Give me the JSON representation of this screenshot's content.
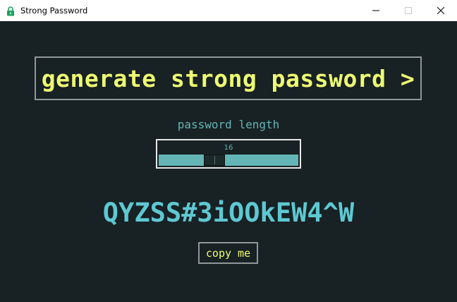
{
  "window": {
    "title": "Strong Password",
    "icon": "lock-icon",
    "controls": [
      "minimize-icon",
      "maximize-icon",
      "close-icon"
    ]
  },
  "main": {
    "generate_label": "generate strong password >",
    "length_label": "password length",
    "slider": {
      "value_text": "16",
      "value": 16,
      "position_fraction": 0.38
    },
    "password": "QYZSS#3iOOkEW4^W",
    "copy_label": "copy me"
  },
  "colors": {
    "background": "#182124",
    "button_text": "#eefc71",
    "accent": "#64b5b5",
    "password_text": "#5ec8d2",
    "border": "#8f9799"
  }
}
